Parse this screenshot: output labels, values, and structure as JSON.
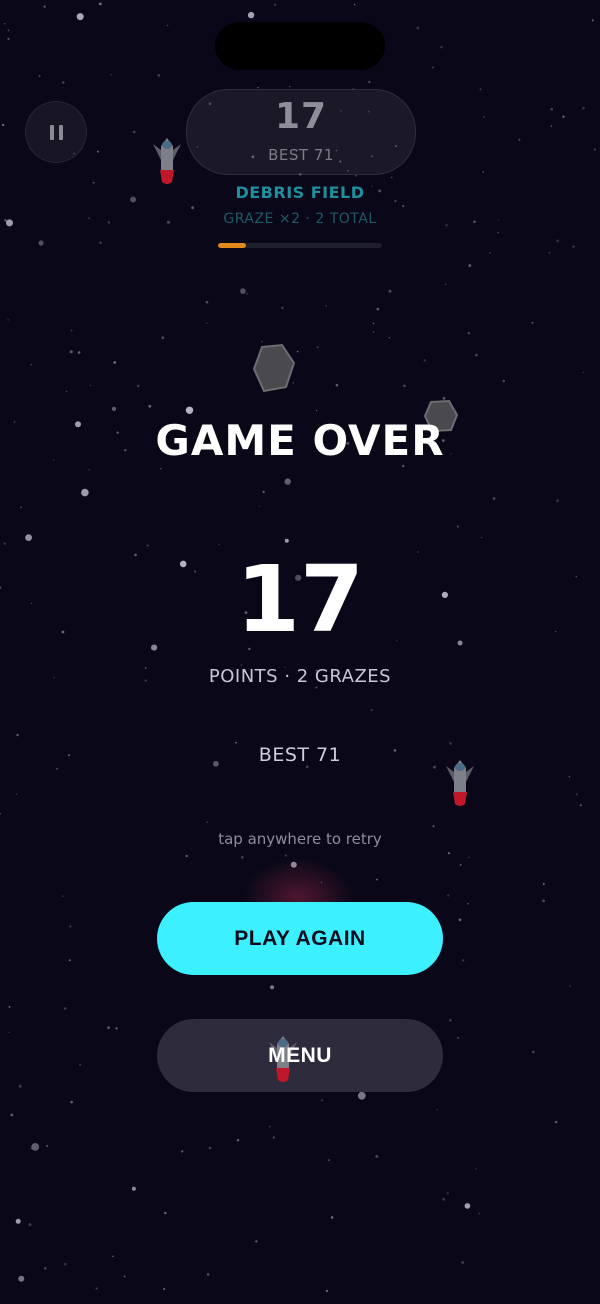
{
  "hud": {
    "score": "17",
    "best": "BEST 71",
    "mode": "DEBRIS FIELD",
    "graze_line": "GRAZE ×2  ·  2 TOTAL",
    "progress_fraction": 0.17
  },
  "game_over": {
    "title": "GAME OVER",
    "score": "17",
    "points_line": "POINTS  ·  2 GRAZES",
    "best_line": "BEST 71",
    "hint": "tap anywhere to retry"
  },
  "buttons": {
    "play_again": "PLAY AGAIN",
    "menu": "MENU"
  },
  "colors": {
    "background": "#0a0818",
    "accent": "#3df0ff",
    "progress": "#e08a1c",
    "menu_button": "#2e2b3d",
    "ship_flame": "#c0182a"
  },
  "icons": {
    "pause": "pause-icon",
    "asteroid": "asteroid-icon",
    "ship": "rocket-icon"
  }
}
